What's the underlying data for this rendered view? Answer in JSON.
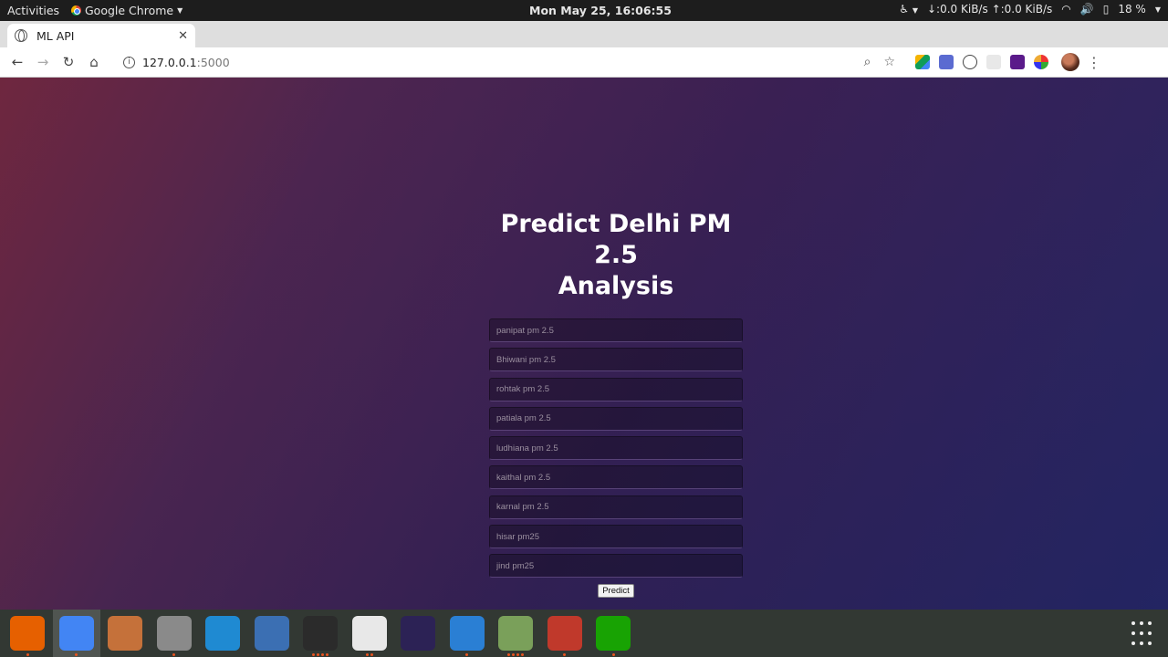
{
  "system": {
    "activities": "Activities",
    "app_name": "Google Chrome",
    "clock": "Mon May 25, 16:06:55",
    "net_down": "↓:0.0 KiB/s",
    "net_up": "↑:0.0 KiB/s",
    "battery": "18 %"
  },
  "browser": {
    "tab_title": "ML API",
    "url_host": "127.0.0.1",
    "url_port": ":5000"
  },
  "page": {
    "heading_line1": "Predict Delhi PM 2.5",
    "heading_line2": "Analysis",
    "fields": [
      {
        "placeholder": "panipat pm 2.5"
      },
      {
        "placeholder": "Bhiwani pm 2.5"
      },
      {
        "placeholder": "rohtak pm 2.5"
      },
      {
        "placeholder": "patiala pm 2.5"
      },
      {
        "placeholder": "ludhiana pm 2.5"
      },
      {
        "placeholder": "kaithal pm 2.5"
      },
      {
        "placeholder": "karnal pm 2.5"
      },
      {
        "placeholder": "hisar pm25"
      },
      {
        "placeholder": "jind pm25"
      }
    ],
    "submit_label": "Predict"
  },
  "dock": {
    "apps": [
      {
        "name": "firefox-icon",
        "color": "#e66000",
        "dots": 1
      },
      {
        "name": "chrome-icon",
        "color": "#4285f4",
        "dots": 1,
        "active": true
      },
      {
        "name": "file-manager-icon",
        "color": "#c5713a",
        "dots": 0
      },
      {
        "name": "archive-manager-icon",
        "color": "#8a8a8a",
        "dots": 1
      },
      {
        "name": "vscode-icon",
        "color": "#1f8ad2",
        "dots": 0
      },
      {
        "name": "water-drop-icon",
        "color": "#3b6fb3",
        "dots": 0
      },
      {
        "name": "terminal-icon",
        "color": "#2b2b2b",
        "dots": 4
      },
      {
        "name": "document-viewer-icon",
        "color": "#e8e8e8",
        "dots": 2
      },
      {
        "name": "eclipse-icon",
        "color": "#2c2255",
        "dots": 0
      },
      {
        "name": "writer-icon",
        "color": "#2a7fd4",
        "dots": 1
      },
      {
        "name": "image-viewer-icon",
        "color": "#7aa05a",
        "dots": 4
      },
      {
        "name": "network-icon",
        "color": "#c0392b",
        "dots": 1
      },
      {
        "name": "calc-icon",
        "color": "#18a303",
        "dots": 1
      }
    ]
  }
}
